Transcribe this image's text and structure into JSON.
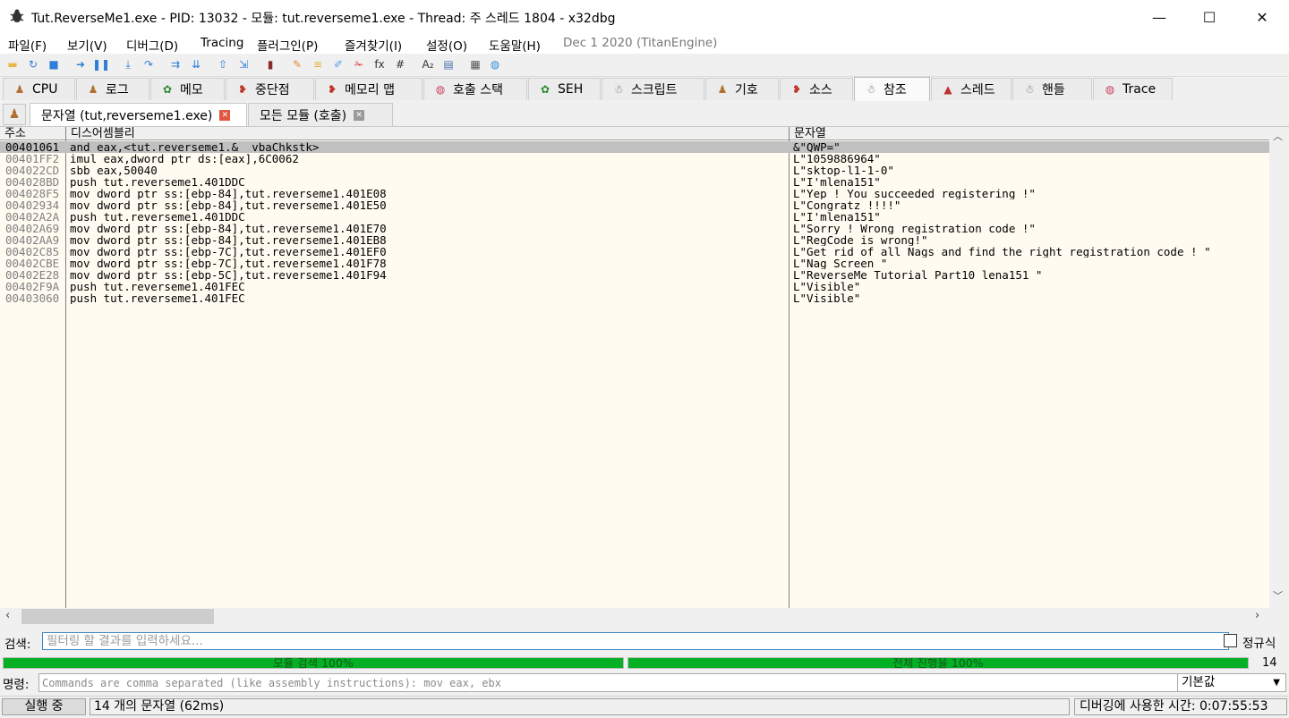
{
  "window": {
    "title": "Tut.ReverseMe1.exe - PID: 13032 - 모듈: tut.reverseme1.exe - Thread: 주 스레드 1804 - x32dbg",
    "minimize": "—",
    "maximize": "☐",
    "close": "✕"
  },
  "menu": {
    "items": [
      "파일(F)",
      "보기(V)",
      "디버그(D)",
      "Tracing",
      "플러그인(P)",
      "즐겨찾기(I)",
      "설정(O)",
      "도움말(H)"
    ],
    "date": "Dec 1 2020 (TitanEngine)"
  },
  "toolbar": {
    "icons": [
      "open-icon",
      "restart-icon",
      "stop-icon",
      "run-icon",
      "pause-icon",
      "step-into-icon",
      "step-over-icon",
      "trace-into-icon",
      "trace-over-icon",
      "execute-till-return-icon",
      "run-to-user-code-icon",
      "scylla-icon",
      "patch-icon",
      "comments-icon",
      "labels-icon",
      "bookmarks-icon",
      "functions-icon",
      "variables-icon",
      "font-icon",
      "breakpoints-icon",
      "calculator-icon",
      "web-icon"
    ],
    "glyphs": [
      "▬",
      "↻",
      "■",
      "➜",
      "❚❚",
      "⤓",
      "↷",
      "⇉",
      "⇊",
      "⇧",
      "⇲",
      "▮",
      "✎",
      "≡",
      "✐",
      "✁",
      "fx",
      "#",
      "A₂",
      "▤",
      "▦",
      "◍"
    ],
    "colors": [
      "#e8b84a",
      "#2f7fd8",
      "#2f7fd8",
      "#2f7fd8",
      "#2f7fd8",
      "#2f7fd8",
      "#2f7fd8",
      "#2f7fd8",
      "#2f7fd8",
      "#2f7fd8",
      "#2f7fd8",
      "#8a2a2a",
      "#e0903a",
      "#e0b030",
      "#5aa0e0",
      "#d03030",
      "#333333",
      "#333333",
      "#333333",
      "#4a70b0",
      "#555555",
      "#2f8fd8"
    ]
  },
  "tabs": [
    {
      "label": "CPU",
      "icon": "cpu-icon",
      "glyph": "♟",
      "color": "#b07030"
    },
    {
      "label": "로그",
      "icon": "log-icon",
      "glyph": "♟",
      "color": "#b07030"
    },
    {
      "label": "메모",
      "icon": "notes-icon",
      "glyph": "✿",
      "color": "#2a8a2a"
    },
    {
      "label": "중단점",
      "icon": "breakpoints-icon",
      "glyph": "❥",
      "color": "#c0392b"
    },
    {
      "label": "메모리 맵",
      "icon": "memory-map-icon",
      "glyph": "❥",
      "color": "#c0392b"
    },
    {
      "label": "호출 스택",
      "icon": "call-stack-icon",
      "glyph": "◍",
      "color": "#d04060"
    },
    {
      "label": "SEH",
      "icon": "seh-icon",
      "glyph": "✿",
      "color": "#2a8a2a"
    },
    {
      "label": "스크립트",
      "icon": "script-icon",
      "glyph": "☃",
      "color": "#707070"
    },
    {
      "label": "기호",
      "icon": "symbols-icon",
      "glyph": "♟",
      "color": "#b07030"
    },
    {
      "label": "소스",
      "icon": "source-icon",
      "glyph": "❥",
      "color": "#c0392b"
    },
    {
      "label": "참조",
      "icon": "references-icon",
      "glyph": "☃",
      "color": "#707070"
    },
    {
      "label": "스레드",
      "icon": "threads-icon",
      "glyph": "▲",
      "color": "#c03030"
    },
    {
      "label": "핸들",
      "icon": "handles-icon",
      "glyph": "☃",
      "color": "#707070"
    },
    {
      "label": "Trace",
      "icon": "trace-icon",
      "glyph": "◍",
      "color": "#d04060"
    }
  ],
  "active_tab": "참조",
  "subtabs": [
    {
      "label": "문자열 (tut,reverseme1.exe)",
      "closeColor": "#e0563f"
    },
    {
      "label": "모든 모듈 (호출)",
      "closeColor": "#9a9a9a"
    }
  ],
  "grid": {
    "headers": {
      "address": "주소",
      "disassembly": "디스어셈블리",
      "string": "문자열"
    },
    "rows": [
      {
        "address": "00401061",
        "disassembly": "and eax,<tut.reverseme1.&__vbaChkstk>",
        "string": "&\"QWP=\""
      },
      {
        "address": "00401FF2",
        "disassembly": "imul eax,dword ptr ds:[eax],6C0062",
        "string": "L\"1059886964\""
      },
      {
        "address": "004022CD",
        "disassembly": "sbb eax,50040",
        "string": "L\"sktop-l1-1-0\""
      },
      {
        "address": "004028BD",
        "disassembly": "push tut.reverseme1.401DDC",
        "string": "L\"I'mlena151\""
      },
      {
        "address": "004028F5",
        "disassembly": "mov dword ptr ss:[ebp-84],tut.reverseme1.401E08",
        "string": "L\"Yep ! You succeeded registering !\""
      },
      {
        "address": "00402934",
        "disassembly": "mov dword ptr ss:[ebp-84],tut.reverseme1.401E50",
        "string": "L\"Congratz !!!!\""
      },
      {
        "address": "00402A2A",
        "disassembly": "push tut.reverseme1.401DDC",
        "string": "L\"I'mlena151\""
      },
      {
        "address": "00402A69",
        "disassembly": "mov dword ptr ss:[ebp-84],tut.reverseme1.401E70",
        "string": "L\"Sorry ! Wrong registration code !\""
      },
      {
        "address": "00402AA9",
        "disassembly": "mov dword ptr ss:[ebp-84],tut.reverseme1.401EB8",
        "string": "L\"RegCode is wrong!\""
      },
      {
        "address": "00402C85",
        "disassembly": "mov dword ptr ss:[ebp-7C],tut.reverseme1.401EF0",
        "string": "L\"Get rid of all Nags and find the right registration code !      \""
      },
      {
        "address": "00402CBE",
        "disassembly": "mov dword ptr ss:[ebp-7C],tut.reverseme1.401F78",
        "string": "L\"Nag Screen \""
      },
      {
        "address": "00402E28",
        "disassembly": "mov dword ptr ss:[ebp-5C],tut.reverseme1.401F94",
        "string": "L\"ReverseMe Tutorial Part10 lena151 \""
      },
      {
        "address": "00402F9A",
        "disassembly": "push tut.reverseme1.401FEC",
        "string": "L\"Visible\""
      },
      {
        "address": "00403060",
        "disassembly": "push tut.reverseme1.401FEC",
        "string": "L\"Visible\""
      }
    ],
    "selected_row": 0
  },
  "search": {
    "label": "검색:",
    "placeholder": "필터링 할 결과를 입력하세요...",
    "value": "",
    "regex_label": "정규식"
  },
  "progress": {
    "module_label": "모듈 검색 100%",
    "module_fraction": 1.0,
    "total_label": "전체 진행율 100%",
    "total_fraction": 1.0,
    "count": "14",
    "color": "#06b025"
  },
  "command": {
    "label": "명령:",
    "placeholder": "Commands are comma separated (like assembly instructions): mov eax, ebx",
    "value": "",
    "engine": "기본값"
  },
  "status": {
    "state": "실행 중",
    "message": "14 개의 문자열 (62ms)",
    "time": "디버깅에 사용한 시간: 0:07:55:53"
  }
}
